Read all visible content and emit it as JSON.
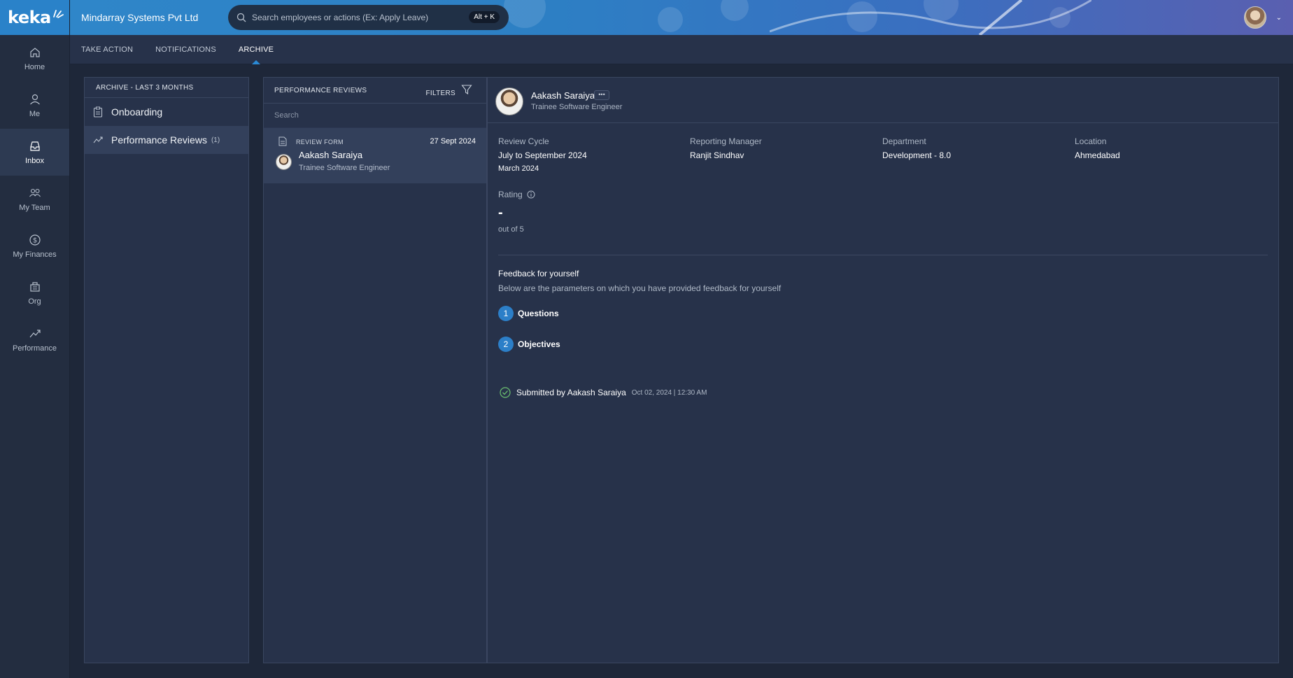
{
  "brand": {
    "logo_text": "keka"
  },
  "sidebar": {
    "items": [
      {
        "label": "Home",
        "icon": "home-icon"
      },
      {
        "label": "Me",
        "icon": "user-icon"
      },
      {
        "label": "Inbox",
        "icon": "inbox-icon",
        "active": true
      },
      {
        "label": "My Team",
        "icon": "team-icon"
      },
      {
        "label": "My Finances",
        "icon": "dollar-icon"
      },
      {
        "label": "Org",
        "icon": "org-icon"
      },
      {
        "label": "Performance",
        "icon": "trend-icon"
      }
    ]
  },
  "header": {
    "company": "Mindarray Systems Pvt Ltd",
    "search_placeholder": "Search employees or actions (Ex: Apply Leave)",
    "shortcut": "Alt + K"
  },
  "tabs": [
    {
      "label": "TAKE ACTION"
    },
    {
      "label": "NOTIFICATIONS"
    },
    {
      "label": "ARCHIVE",
      "active": true
    }
  ],
  "archive": {
    "title": "ARCHIVE - LAST 3 MONTHS",
    "items": [
      {
        "label": "Onboarding",
        "count": ""
      },
      {
        "label": "Performance Reviews",
        "count": "(1)",
        "active": true
      }
    ]
  },
  "reviews": {
    "title": "PERFORMANCE REVIEWS",
    "filters_label": "FILTERS",
    "search_placeholder": "Search",
    "cards": [
      {
        "type": "REVIEW FORM",
        "date": "27 Sept 2024",
        "name": "Aakash Saraiya",
        "designation": "Trainee Software Engineer"
      }
    ]
  },
  "detail": {
    "name": "Aakash Saraiya",
    "more_label": "•••",
    "designation": "Trainee Software Engineer",
    "fields": {
      "review_cycle_label": "Review Cycle",
      "review_cycle_value": "July to September 2024",
      "review_cycle_sub": "March 2024",
      "manager_label": "Reporting Manager",
      "manager_value": "Ranjit Sindhav",
      "department_label": "Department",
      "department_value": "Development - 8.0",
      "location_label": "Location",
      "location_value": "Ahmedabad"
    },
    "rating": {
      "label": "Rating",
      "value": "-",
      "out_of": "out of 5"
    },
    "feedback": {
      "heading": "Feedback for yourself",
      "subtext": "Below are the parameters on which you have provided feedback for yourself",
      "steps": [
        {
          "num": "1",
          "label": "Questions"
        },
        {
          "num": "2",
          "label": "Objectives"
        }
      ]
    },
    "submitted": {
      "text": "Submitted by Aakash Saraiya",
      "time": "Oct 02, 2024 | 12:30 AM"
    }
  },
  "colors": {
    "accent": "#2c7fc8",
    "brand_blue": "#2a82c9",
    "success": "#6cc070"
  }
}
